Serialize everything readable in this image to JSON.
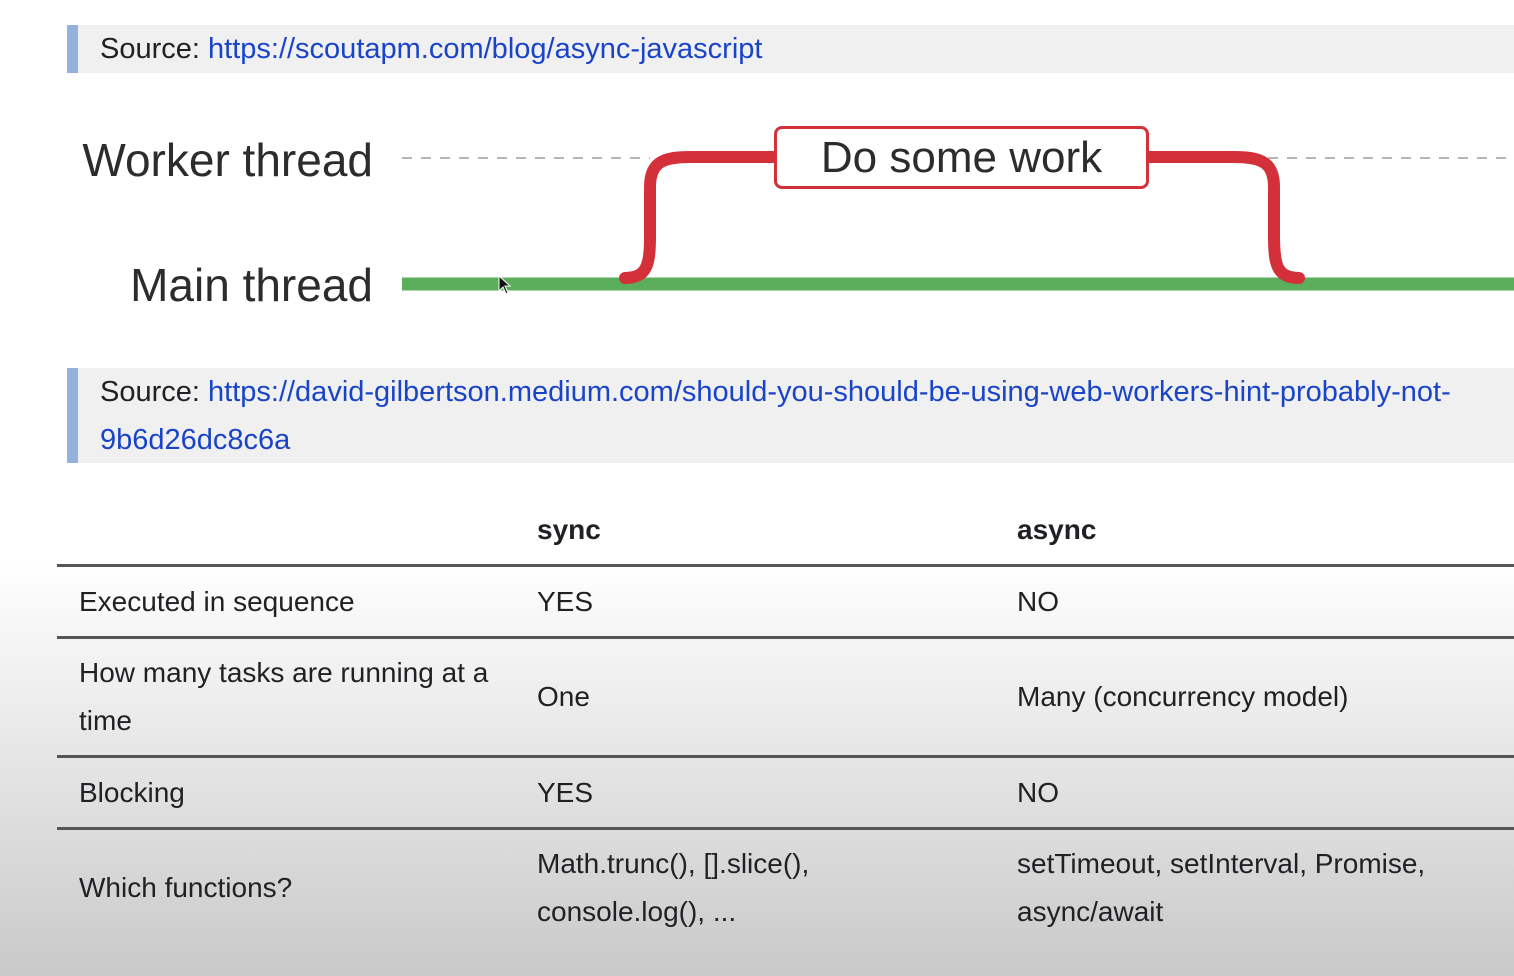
{
  "sources": [
    {
      "label": "Source:",
      "url": "https://scoutapm.com/blog/async-javascript"
    },
    {
      "label": "Source:",
      "url": "https://david-gilbertson.medium.com/should-you-should-be-using-web-workers-hint-probably-not-9b6d26dc8c6a"
    }
  ],
  "diagram": {
    "worker_label": "Worker thread",
    "main_label": "Main thread",
    "task_label": "Do some work",
    "colors": {
      "main_thread": "#5bae5b",
      "worker_path": "#d3303a",
      "worker_dashes": "#b5b5b5"
    }
  },
  "table": {
    "headers": [
      "",
      "sync",
      "async"
    ],
    "rows": [
      [
        "Executed in sequence",
        "YES",
        "NO"
      ],
      [
        "How many tasks are running at a time",
        "One",
        "Many (concurrency model)"
      ],
      [
        "Blocking",
        "YES",
        "NO"
      ],
      [
        "Which functions?",
        "Math.trunc(), [].slice(), console.log(), ...",
        "setTimeout, setInterval, Promise, async/await"
      ]
    ]
  }
}
